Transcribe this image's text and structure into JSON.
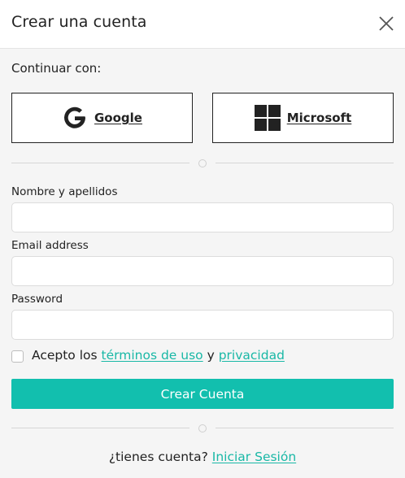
{
  "dialog": {
    "title": "Crear una cuenta",
    "close_icon": "close-icon"
  },
  "oauth": {
    "heading": "Continuar con:",
    "google": {
      "label": "Google",
      "icon": "google-g-icon"
    },
    "microsoft": {
      "label": "Microsoft",
      "icon": "microsoft-windows-icon"
    }
  },
  "form": {
    "name": {
      "label": "Nombre y apellidos",
      "value": "",
      "placeholder": ""
    },
    "email": {
      "label": "Email address",
      "value": "",
      "placeholder": ""
    },
    "password": {
      "label": "Password",
      "value": "",
      "placeholder": ""
    },
    "terms": {
      "checked": false,
      "prefix": "Acepto los",
      "terms_link": "términos de uso",
      "conjunction": "y",
      "privacy_link": "privacidad"
    },
    "submit_label": "Crear Cuenta"
  },
  "footer": {
    "question": "¿tienes cuenta?",
    "signin_link": "Iniciar Sesión"
  },
  "colors": {
    "accent": "#12bfae",
    "link": "#19b8a6",
    "background": "#f5f5f5",
    "text": "#222222"
  }
}
